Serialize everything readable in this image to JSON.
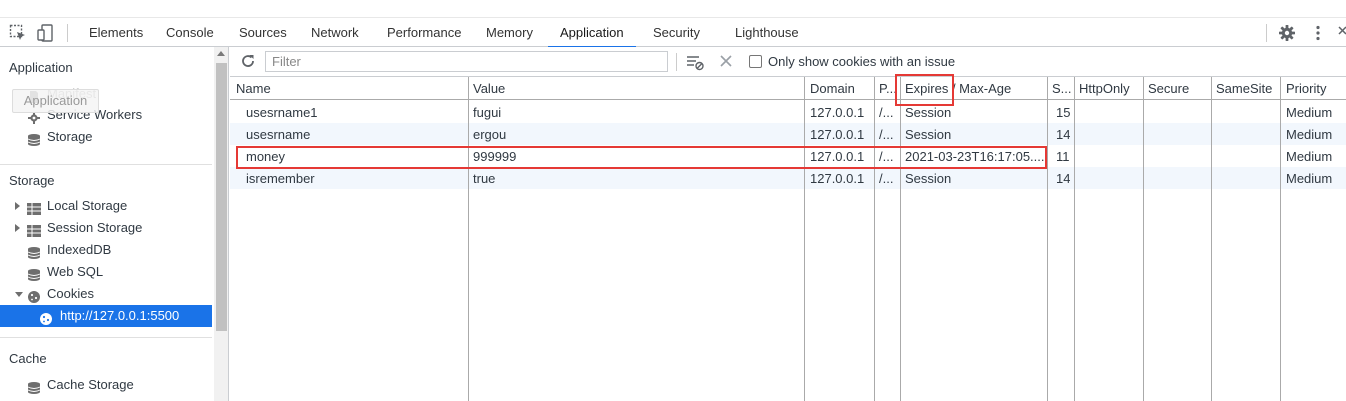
{
  "devtools": {
    "tabs": [
      "Elements",
      "Console",
      "Sources",
      "Network",
      "Performance",
      "Memory",
      "Application",
      "Security",
      "Lighthouse"
    ],
    "active_tab": "Application"
  },
  "sidebar": {
    "application_title": "Application",
    "application_items": [
      "Manifest",
      "Service Workers",
      "Storage"
    ],
    "drag_ghost": "Application",
    "storage_title": "Storage",
    "storage_items": [
      "Local Storage",
      "Session Storage",
      "IndexedDB",
      "Web SQL",
      "Cookies"
    ],
    "cookie_origin": "http://127.0.0.1:5500",
    "cache_title": "Cache",
    "cache_items": [
      "Cache Storage"
    ]
  },
  "toolbar": {
    "filter_placeholder": "Filter",
    "only_issue_label": "Only show cookies with an issue"
  },
  "cookies_table": {
    "headers": [
      "Name",
      "Value",
      "Domain",
      "P...",
      "Expires / Max-Age",
      "S...",
      "HttpOnly",
      "Secure",
      "SameSite",
      "Priority"
    ],
    "rows": [
      [
        "usesrname1",
        "fugui",
        "127.0.0.1",
        "/...",
        "Session",
        "15",
        "",
        "",
        "",
        "Medium"
      ],
      [
        "usesrname",
        "ergou",
        "127.0.0.1",
        "/...",
        "Session",
        "14",
        "",
        "",
        "",
        "Medium"
      ],
      [
        "money",
        "999999",
        "127.0.0.1",
        "/...",
        "2021-03-23T16:17:05....",
        "11",
        "",
        "",
        "",
        "Medium"
      ],
      [
        "isremember",
        "true",
        "127.0.0.1",
        "/...",
        "Session",
        "14",
        "",
        "",
        "",
        "Medium"
      ]
    ]
  },
  "colors": {
    "accent": "#1a73e8",
    "highlight": "#e53935",
    "alt_row": "#f2f7fd"
  }
}
